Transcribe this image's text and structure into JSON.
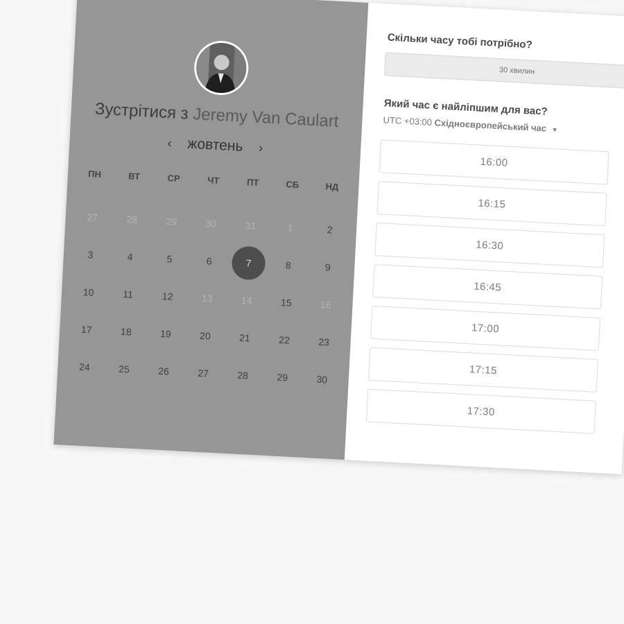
{
  "header": {
    "meet_prefix": "Зустрітися з",
    "host_name": "Jeremy Van Caulart"
  },
  "calendar": {
    "prev_label": "‹",
    "month": "жовтень",
    "next_label": "›",
    "weekdays": [
      "ПН",
      "ВТ",
      "СР",
      "ЧТ",
      "ПТ",
      "СБ",
      "НД"
    ],
    "days": [
      "27",
      "28",
      "29",
      "30",
      "31",
      "1",
      "2",
      "3",
      "4",
      "5",
      "6",
      "7",
      "8",
      "9",
      "10",
      "11",
      "12",
      "13",
      "14",
      "15",
      "16",
      "17",
      "18",
      "19",
      "20",
      "21",
      "22",
      "23",
      "24",
      "25",
      "26",
      "27",
      "28",
      "29",
      "30"
    ],
    "selected_day": "7"
  },
  "booking": {
    "duration_question": "Скільки часу тобі потрібно?",
    "duration_value": "30 хвилин",
    "time_question": "Який час є найліпшим для вас?",
    "timezone_offset": "UTC +03:00",
    "timezone_name": "Східноєвропейський час",
    "slots": [
      "16:00",
      "16:15",
      "16:30",
      "16:45",
      "17:00",
      "17:15",
      "17:30"
    ]
  },
  "colors": {
    "left_panel": "#969696",
    "selected_day": "#4d4d4d",
    "background": "#f7f7f7"
  }
}
